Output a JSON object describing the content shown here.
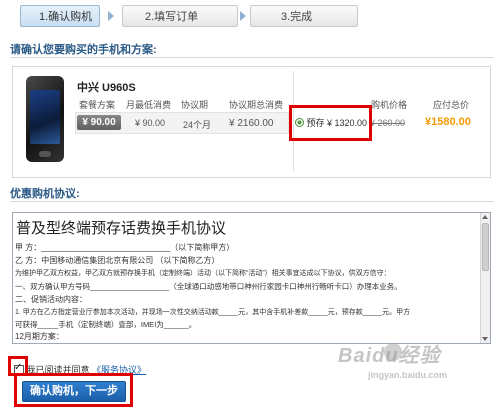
{
  "steps": [
    {
      "label": "1.确认购机"
    },
    {
      "label": "2.填写订单"
    },
    {
      "label": "3.完成"
    }
  ],
  "section1_title": "请确认您要购买的手机和方案:",
  "product": {
    "name": "中兴  U960S",
    "headers": [
      "套餐方案",
      "月最低消费",
      "协议期",
      "协议期总消费"
    ],
    "plan_price": "¥ 90.00",
    "monthly_min": "¥ 90.00",
    "term": "24个月",
    "total": "¥ 2160.00",
    "option_label": "预存 ¥ 1320.00",
    "col_price_header": "购机价格",
    "col_total_header": "应付总价",
    "price": "¥ 260.00",
    "total_due": "¥1580.00"
  },
  "section2_title": "优惠购机协议:",
  "agreement": {
    "title": "普及型终端预存话费换手机协议",
    "lines": [
      "甲    方：_____________________________（以下简称甲方）",
      "乙    方：中国移动通信集团北京有限公司                （以下简称乙方）",
      "      为维护甲乙双方权益，甲乙双方就预存换手机（定制终端）活动（以下简称“活动”）相关事宜达成以下协议，供双方信守：",
      "一、双方确认甲方号码___________________（全球通口动感地带口神州行家园卡口神州行畅听卡口）办理本业务。",
      "二、促销活动内容：",
      "      1.  甲方在乙方指定营业厅参加本次活动，并现场一次性交纳活动款_____元，其中含手机补差款_____元，预存款_____元。甲方",
      "          可获得_____手机（定制终端）壹部，IMEI为______。",
      "12月期方案："
    ]
  },
  "agree": {
    "text": "我已阅读并同意",
    "link": "《服务协议》"
  },
  "submit_label": "确认购机，下一步",
  "watermark": {
    "brand": "Baidu经验",
    "url": "jingyan.baidu.com"
  },
  "colors": {
    "accent_red": "#e10000",
    "price_orange": "#f39a00",
    "title_blue": "#2a5a86",
    "button_blue": "#1b5fa8"
  }
}
